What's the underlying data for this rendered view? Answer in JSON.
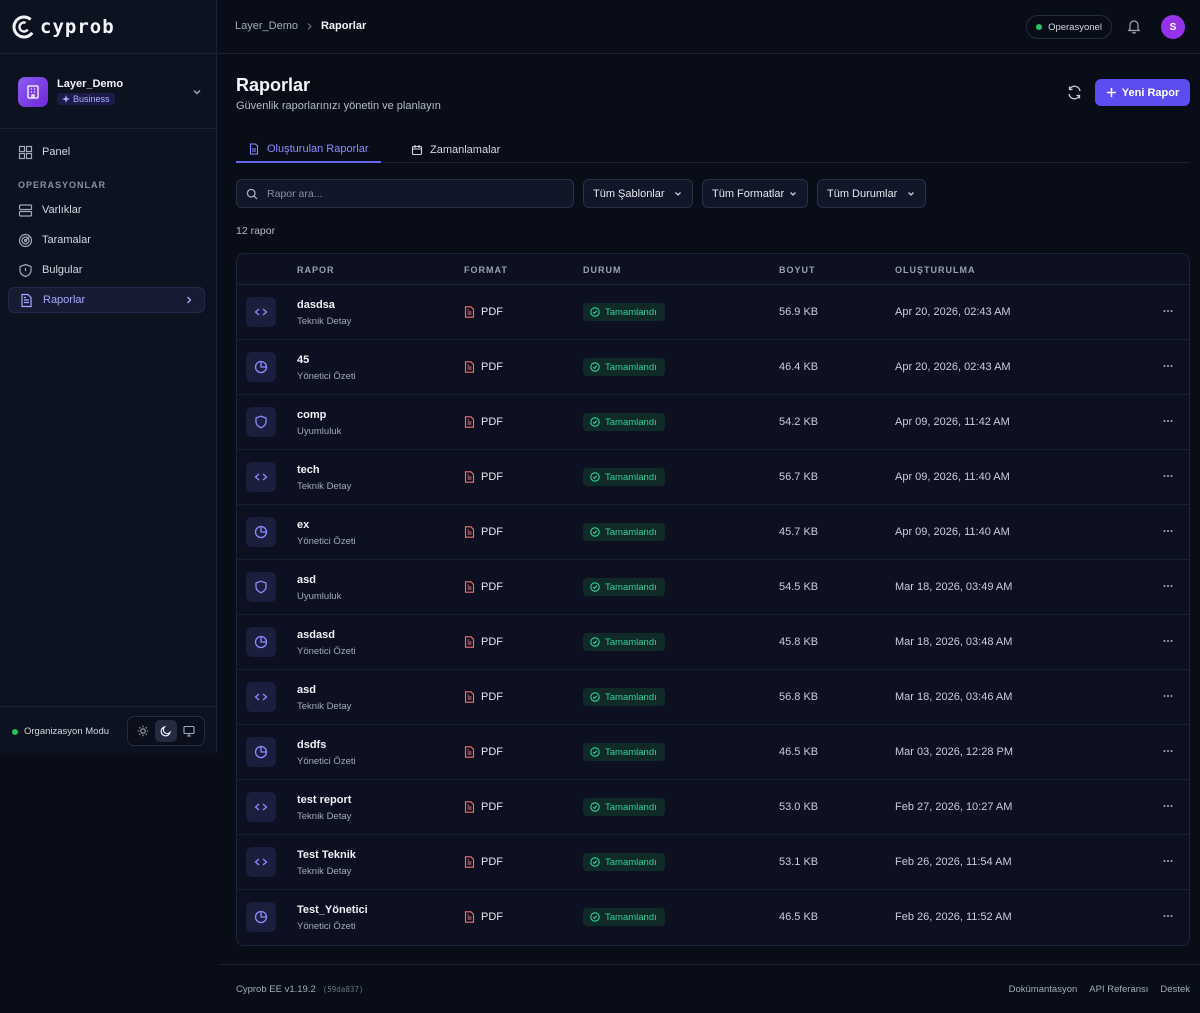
{
  "brand": {
    "name": "cyprob"
  },
  "workspace": {
    "name": "Layer_Demo",
    "plan": "Business"
  },
  "nav": {
    "panel": "Panel",
    "section_label": "OPERASYONLAR",
    "items": [
      {
        "label": "Varlıklar",
        "icon": "server-icon"
      },
      {
        "label": "Taramalar",
        "icon": "radar-icon"
      },
      {
        "label": "Bulgular",
        "icon": "shield-alert-icon"
      },
      {
        "label": "Raporlar",
        "icon": "document-icon",
        "active": true
      }
    ]
  },
  "org_mode": {
    "label": "Organizasyon Modu"
  },
  "topbar": {
    "breadcrumb_parent": "Layer_Demo",
    "breadcrumb_current": "Raporlar",
    "status": "Operasyonel",
    "avatar_initial": "S"
  },
  "page": {
    "title": "Raporlar",
    "subtitle": "Güvenlik raporlarınızı yönetin ve planlayın",
    "new_button": "Yeni Rapor"
  },
  "tabs": [
    {
      "label": "Oluşturulan Raporlar",
      "active": true
    },
    {
      "label": "Zamanlamalar",
      "active": false
    }
  ],
  "filters": {
    "search_placeholder": "Rapor ara...",
    "template": "Tüm Şablonlar",
    "format": "Tüm Formatlar",
    "status": "Tüm Durumlar"
  },
  "count_label": "12 rapor",
  "table": {
    "headers": {
      "report": "RAPOR",
      "format": "FORMAT",
      "status": "DURUM",
      "size": "BOYUT",
      "created": "OLUŞTURULMA"
    },
    "rows": [
      {
        "name": "dasdsa",
        "type": "Teknik Detay",
        "icon": "code-icon",
        "format": "PDF",
        "status": "Tamamlandı",
        "size": "56.9 KB",
        "created": "Apr 20, 2026, 02:43 AM"
      },
      {
        "name": "45",
        "type": "Yönetici Özeti",
        "icon": "pie-chart-icon",
        "format": "PDF",
        "status": "Tamamlandı",
        "size": "46.4 KB",
        "created": "Apr 20, 2026, 02:43 AM"
      },
      {
        "name": "comp",
        "type": "Uyumluluk",
        "icon": "shield-icon",
        "format": "PDF",
        "status": "Tamamlandı",
        "size": "54.2 KB",
        "created": "Apr 09, 2026, 11:42 AM"
      },
      {
        "name": "tech",
        "type": "Teknik Detay",
        "icon": "code-icon",
        "format": "PDF",
        "status": "Tamamlandı",
        "size": "56.7 KB",
        "created": "Apr 09, 2026, 11:40 AM"
      },
      {
        "name": "ex",
        "type": "Yönetici Özeti",
        "icon": "pie-chart-icon",
        "format": "PDF",
        "status": "Tamamlandı",
        "size": "45.7 KB",
        "created": "Apr 09, 2026, 11:40 AM"
      },
      {
        "name": "asd",
        "type": "Uyumluluk",
        "icon": "shield-icon",
        "format": "PDF",
        "status": "Tamamlandı",
        "size": "54.5 KB",
        "created": "Mar 18, 2026, 03:49 AM"
      },
      {
        "name": "asdasd",
        "type": "Yönetici Özeti",
        "icon": "pie-chart-icon",
        "format": "PDF",
        "status": "Tamamlandı",
        "size": "45.8 KB",
        "created": "Mar 18, 2026, 03:48 AM"
      },
      {
        "name": "asd",
        "type": "Teknik Detay",
        "icon": "code-icon",
        "format": "PDF",
        "status": "Tamamlandı",
        "size": "56.8 KB",
        "created": "Mar 18, 2026, 03:46 AM"
      },
      {
        "name": "dsdfs",
        "type": "Yönetici Özeti",
        "icon": "pie-chart-icon",
        "format": "PDF",
        "status": "Tamamlandı",
        "size": "46.5 KB",
        "created": "Mar 03, 2026, 12:28 PM"
      },
      {
        "name": "test report",
        "type": "Teknik Detay",
        "icon": "code-icon",
        "format": "PDF",
        "status": "Tamamlandı",
        "size": "53.0 KB",
        "created": "Feb 27, 2026, 10:27 AM"
      },
      {
        "name": "Test Teknik",
        "type": "Teknik Detay",
        "icon": "code-icon",
        "format": "PDF",
        "status": "Tamamlandı",
        "size": "53.1 KB",
        "created": "Feb 26, 2026, 11:54 AM"
      },
      {
        "name": "Test_Yönetici",
        "type": "Yönetici Özeti",
        "icon": "pie-chart-icon",
        "format": "PDF",
        "status": "Tamamlandı",
        "size": "46.5 KB",
        "created": "Feb 26, 2026, 11:52 AM"
      }
    ]
  },
  "footer": {
    "version": "Cyprob EE v1.19.2",
    "hash": "(59da837)",
    "links": [
      "Dokümantasyon",
      "API Referansı",
      "Destek"
    ]
  },
  "colors": {
    "accent": "#5b4df0",
    "success": "#34d399",
    "pdf": "#f87171",
    "background": "#090d18"
  }
}
